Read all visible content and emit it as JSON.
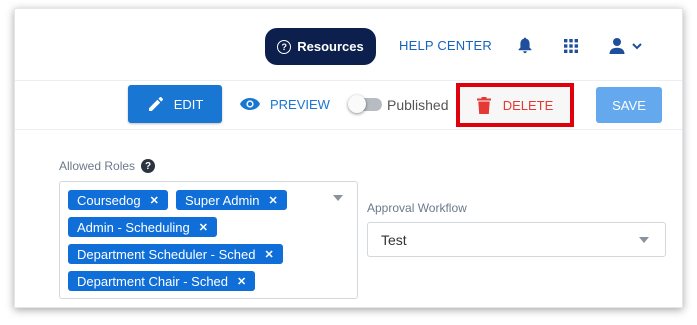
{
  "header": {
    "resources_label": "Resources",
    "help_center_label": "HELP CENTER"
  },
  "actions": {
    "edit_label": "EDIT",
    "preview_label": "PREVIEW",
    "published_label": "Published",
    "published_on": false,
    "delete_label": "DELETE",
    "save_label": "SAVE"
  },
  "form": {
    "roles": {
      "label": "Allowed Roles",
      "chips": [
        "Coursedog",
        "Super Admin",
        "Admin - Scheduling",
        "Department Scheduler - Sched",
        "Department Chair - Sched"
      ]
    },
    "workflow": {
      "label": "Approval Workflow",
      "value": "Test"
    }
  },
  "colors": {
    "primary": "#1976d2",
    "resources_bg": "#0d1f4c",
    "delete_text": "#e53935",
    "highlight_border": "#e0000b",
    "chip_bg": "#0f6ed8",
    "save_disabled": "#64a8ee"
  },
  "icons": [
    "help-icon",
    "bell-icon",
    "apps-grid-icon",
    "user-icon",
    "chevron-down-icon",
    "pencil-icon",
    "eye-icon",
    "trash-icon",
    "close-icon",
    "caret-down-icon"
  ]
}
